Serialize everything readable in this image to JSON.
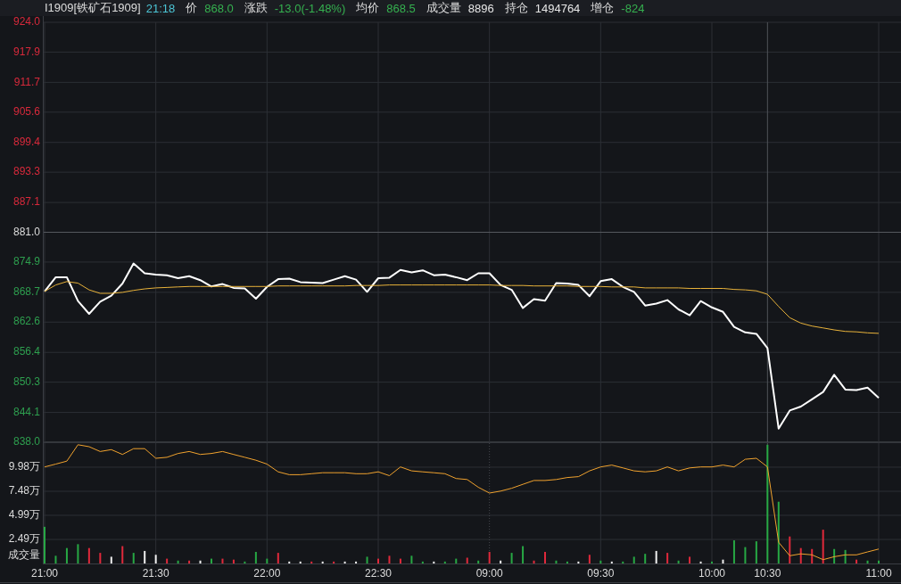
{
  "quote_bar": {
    "symbol": "I1909[铁矿石1909]",
    "time": "21:18",
    "fields": [
      {
        "label": "价",
        "value": "868.0",
        "color": "#35b04f"
      },
      {
        "label": "涨跌",
        "value": "-13.0(-1.48%)",
        "color": "#35b04f"
      },
      {
        "label": "均价",
        "value": "868.5",
        "color": "#35b04f"
      },
      {
        "label": "成交量",
        "value": "8896",
        "color": "#e6e6e6"
      },
      {
        "label": "持仓",
        "value": "1494764",
        "color": "#e6e6e6"
      },
      {
        "label": "增仓",
        "value": "-824",
        "color": "#35b04f"
      }
    ]
  },
  "price_panel": {
    "chart_data": {
      "type": "line",
      "grid": true,
      "categories": [
        null,
        null,
        null,
        null,
        null,
        null,
        null,
        null,
        null,
        null,
        null,
        null,
        null,
        null,
        null,
        null,
        null,
        null,
        null,
        null,
        null,
        null,
        null,
        null,
        null,
        null,
        null,
        null,
        null,
        null,
        null,
        null,
        null,
        null,
        null,
        null,
        null,
        null,
        null,
        null,
        null,
        null,
        null,
        null,
        null,
        null,
        null,
        null,
        null,
        null,
        null,
        null,
        null,
        null,
        null,
        null,
        null,
        null,
        null,
        null,
        null,
        null,
        null,
        null,
        null,
        null,
        null,
        null,
        null,
        null,
        null,
        null,
        null,
        null,
        null,
        null
      ],
      "ylim": [
        838.0,
        924.0
      ],
      "yticks": [
        {
          "value": 924.0,
          "label": "924.0"
        },
        {
          "value": 917.9,
          "label": "917.9"
        },
        {
          "value": 911.7,
          "label": "911.7"
        },
        {
          "value": 905.6,
          "label": "905.6"
        },
        {
          "value": 899.4,
          "label": "899.4"
        },
        {
          "value": 893.3,
          "label": "893.3"
        },
        {
          "value": 887.1,
          "label": "887.1"
        },
        {
          "value": 881.0,
          "label": "881.0"
        },
        {
          "value": 874.9,
          "label": "874.9"
        },
        {
          "value": 868.7,
          "label": "868.7"
        },
        {
          "value": 862.6,
          "label": "862.6"
        },
        {
          "value": 856.4,
          "label": "856.4"
        },
        {
          "value": 850.3,
          "label": "850.3"
        },
        {
          "value": 844.1,
          "label": "844.1"
        },
        {
          "value": 838.0,
          "label": "838.0"
        }
      ],
      "ref_lines": [
        {
          "axis": "y",
          "value": 881.0
        }
      ],
      "series": [
        {
          "color": "#ffffff",
          "values": [
            868.9,
            871.8,
            871.8,
            866.9,
            864.3,
            866.8,
            868.0,
            870.5,
            874.6,
            872.6,
            872.3,
            872.2,
            871.6,
            872.0,
            871.2,
            869.9,
            870.4,
            869.6,
            869.5,
            867.4,
            869.8,
            871.4,
            871.5,
            870.8,
            870.7,
            870.6,
            871.3,
            872.0,
            871.3,
            868.8,
            871.6,
            871.7,
            873.3,
            872.8,
            873.2,
            872.2,
            872.3,
            871.8,
            871.2,
            872.6,
            872.6,
            870.2,
            869.2,
            865.5,
            867.3,
            867.0,
            870.6,
            870.5,
            870.2,
            867.9,
            871.0,
            871.4,
            869.8,
            868.8,
            866.0,
            866.4,
            867.1,
            865.2,
            864.0,
            866.9,
            865.6,
            864.7,
            861.6,
            860.5,
            860.2,
            857.3,
            840.8,
            844.5,
            845.3,
            846.8,
            848.3,
            851.8,
            848.8,
            848.7,
            849.2,
            847.1
          ]
        },
        {
          "color": "#e8b23a",
          "values": [
            868.9,
            870.2,
            870.9,
            870.6,
            869.2,
            868.5,
            868.5,
            868.7,
            869.1,
            869.4,
            869.6,
            869.7,
            869.8,
            869.9,
            869.9,
            869.9,
            869.9,
            869.9,
            869.9,
            869.9,
            869.9,
            870.0,
            870.0,
            870.0,
            870.0,
            870.0,
            870.0,
            870.0,
            870.1,
            870.1,
            870.1,
            870.2,
            870.2,
            870.2,
            870.2,
            870.2,
            870.2,
            870.2,
            870.2,
            870.2,
            870.2,
            870.1,
            870.1,
            870.1,
            870.0,
            870.0,
            870.0,
            870.0,
            869.9,
            869.9,
            869.9,
            869.8,
            869.8,
            869.8,
            869.6,
            869.6,
            869.6,
            869.6,
            869.5,
            869.5,
            869.5,
            869.5,
            869.3,
            869.2,
            869.0,
            868.3,
            865.8,
            863.5,
            862.4,
            861.8,
            861.4,
            861.0,
            860.7,
            860.6,
            860.4,
            860.3
          ]
        }
      ]
    }
  },
  "volume_panel": {
    "chart_data": {
      "type": "bar",
      "grid": true,
      "ylabel": "成交量",
      "categories": [
        "21:00",
        null,
        null,
        null,
        null,
        null,
        null,
        null,
        null,
        null,
        "21:30",
        null,
        null,
        null,
        null,
        null,
        null,
        null,
        null,
        null,
        "22:00",
        null,
        null,
        null,
        null,
        null,
        null,
        null,
        null,
        null,
        "22:30",
        null,
        null,
        null,
        null,
        null,
        null,
        null,
        null,
        null,
        "09:00",
        null,
        null,
        null,
        null,
        null,
        null,
        null,
        null,
        null,
        "09:30",
        null,
        null,
        null,
        null,
        null,
        null,
        null,
        null,
        null,
        "10:00",
        null,
        null,
        null,
        null,
        "10:30",
        null,
        null,
        null,
        null,
        null,
        null,
        null,
        null,
        null,
        "11:00"
      ],
      "ylim": [
        0,
        12.47
      ],
      "yticks": [
        {
          "value": 2.49,
          "label": "2.49万"
        },
        {
          "value": 4.99,
          "label": "4.99万"
        },
        {
          "value": 7.48,
          "label": "7.48万"
        },
        {
          "value": 9.98,
          "label": "9.98万"
        }
      ],
      "series": [
        {
          "colors": [
            "#27a844",
            "#27a844",
            "#27a844",
            "#27a844",
            "#e0293b",
            "#e0293b",
            "#f0f0f0",
            "#e0293b",
            "#27a844",
            "#f0f0f0",
            "#f0f0f0",
            "#e0293b",
            "#27a844",
            "#e0293b",
            "#f0f0f0",
            "#27a844",
            "#e0293b",
            "#e0293b",
            "#27a844",
            "#27a844",
            "#27a844",
            "#e0293b",
            "#f0f0f0",
            "#f0f0f0",
            "#e0293b",
            "#f0f0f0",
            "#e0293b",
            "#f0f0f0",
            "#f0f0f0",
            "#27a844",
            "#e0293b",
            "#e0293b",
            "#e0293b",
            "#27a844",
            "#27a844",
            "#f0f0f0",
            "#27a844",
            "#27a844",
            "#e0293b",
            "#27a844",
            "#e0293b",
            "#f0f0f0",
            "#27a844",
            "#27a844",
            "#e0293b",
            "#e0293b",
            "#27a844",
            "#27a844",
            "#f0f0f0",
            "#e0293b",
            "#27a844",
            "#f0f0f0",
            "#27a844",
            "#27a844",
            "#27a844",
            "#f0f0f0",
            "#e0293b",
            "#27a844",
            "#e0293b",
            "#f0f0f0",
            "#27a844",
            "#f0f0f0",
            "#27a844",
            "#27a844",
            "#27a844",
            "#27a844",
            "#27a844",
            "#e0293b",
            "#e0293b",
            "#e0293b",
            "#e0293b",
            "#27a844",
            "#27a844",
            "#e0293b",
            "#27a844",
            "#27a844"
          ],
          "values": [
            3.8,
            0.8,
            1.6,
            2.0,
            1.6,
            1.1,
            0.7,
            1.8,
            1.1,
            1.3,
            0.9,
            0.5,
            0.3,
            0.3,
            0.3,
            0.5,
            0.5,
            0.4,
            0.2,
            1.2,
            0.5,
            1.1,
            0.2,
            0.2,
            0.2,
            0.2,
            0.2,
            0.2,
            0.2,
            0.7,
            0.5,
            0.8,
            0.5,
            0.8,
            0.2,
            0.2,
            0.2,
            0.5,
            0.6,
            0.3,
            1.2,
            0.3,
            1.1,
            1.8,
            0.3,
            1.2,
            0.3,
            0.2,
            0.2,
            0.9,
            0.3,
            0.2,
            0.2,
            0.7,
            1.0,
            1.3,
            1.1,
            0.3,
            0.7,
            0.2,
            0.2,
            0.4,
            2.4,
            1.7,
            2.3,
            12.3,
            6.4,
            2.8,
            1.6,
            1.5,
            3.5,
            1.5,
            1.4,
            0.4,
            0.3,
            0.3
          ]
        },
        {
          "type": "line",
          "color": "#f0a22e",
          "values": [
            10.0,
            10.3,
            10.6,
            12.3,
            12.1,
            11.6,
            11.8,
            11.3,
            11.9,
            11.9,
            10.9,
            11.0,
            11.4,
            11.6,
            11.3,
            11.4,
            11.6,
            11.3,
            11.0,
            10.7,
            10.3,
            9.5,
            9.2,
            9.2,
            9.3,
            9.4,
            9.4,
            9.4,
            9.3,
            9.3,
            9.5,
            9.1,
            10.0,
            9.6,
            9.5,
            9.4,
            9.3,
            8.8,
            8.7,
            7.9,
            7.3,
            7.5,
            7.8,
            8.2,
            8.6,
            8.6,
            8.7,
            8.9,
            9.0,
            9.6,
            10.0,
            10.2,
            9.9,
            9.6,
            9.5,
            9.6,
            10.0,
            9.6,
            9.9,
            10.0,
            10.0,
            10.2,
            10.0,
            10.8,
            10.9,
            10.0,
            2.2,
            0.8,
            1.0,
            0.9,
            0.4,
            0.7,
            0.9,
            0.9,
            1.2,
            1.5
          ]
        }
      ]
    }
  }
}
